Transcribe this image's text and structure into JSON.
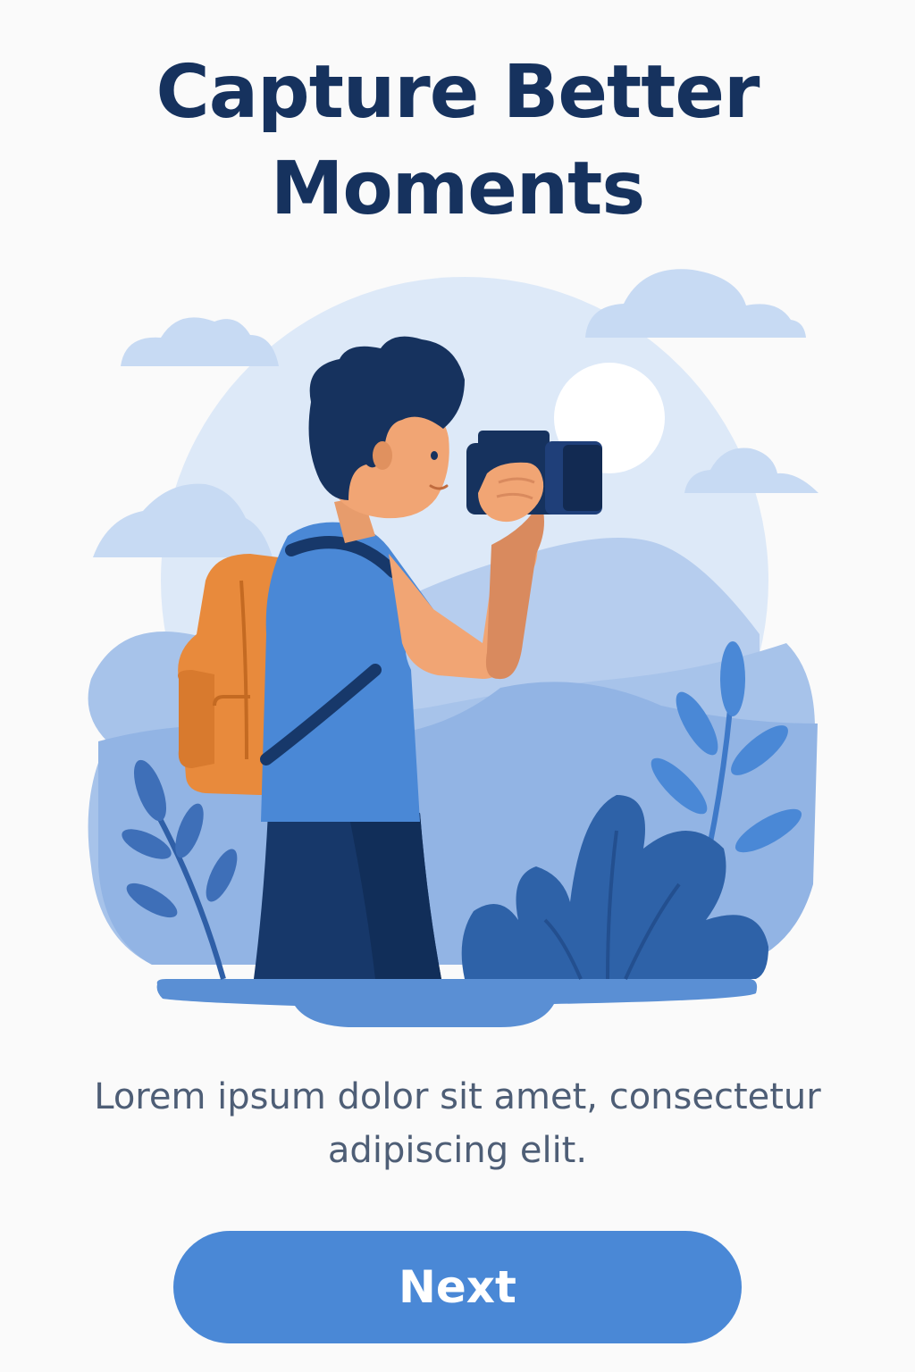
{
  "onboarding": {
    "title_line1": "Capture Better",
    "title_line2": "Moments",
    "description_line1": "Lorem ipsum dolor sit amet, consectetur",
    "description_line2": "adipiscing elit.",
    "next_label": "Next",
    "illustration": "photographer-with-camera-illustration"
  },
  "colors": {
    "title": "#16325e",
    "body_text": "#4e5e76",
    "primary_button": "#4a88d6",
    "background": "#fafafa",
    "backpack": "#e88a3c"
  }
}
